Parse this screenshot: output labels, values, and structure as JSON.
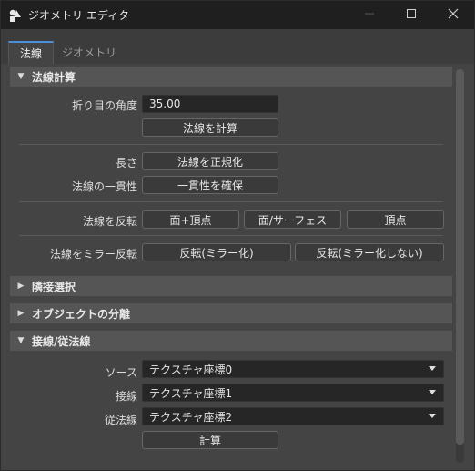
{
  "window": {
    "title": "ジオメトリ エディタ",
    "app_icon": "geometry-editor-icon",
    "minimize_icon": "minimize-icon",
    "maximize_icon": "maximize-icon",
    "close_icon": "close-icon"
  },
  "tabs": [
    {
      "label": "法線",
      "active": true
    },
    {
      "label": "ジオメトリ",
      "active": false
    }
  ],
  "sections": {
    "normal_calc": {
      "title": "法線計算",
      "expanded": true,
      "crease_angle_label": "折り目の角度",
      "crease_angle_value": "35.00",
      "compute_normals_button": "法線を計算",
      "length_label": "長さ",
      "normalize_button": "法線を正規化",
      "consistency_label": "法線の一貫性",
      "ensure_consistency_button": "一貫性を確保",
      "flip_label": "法線を反転",
      "flip_buttons": [
        "面+頂点",
        "面/サーフェス",
        "頂点"
      ],
      "mirror_flip_label": "法線をミラー反転",
      "mirror_buttons": [
        "反転(ミラー化)",
        "反転(ミラー化しない)"
      ]
    },
    "adjacency": {
      "title": "隣接選択",
      "expanded": false
    },
    "object_split": {
      "title": "オブジェクトの分離",
      "expanded": false
    },
    "tangent": {
      "title": "接線/従法線",
      "expanded": true,
      "source_label": "ソース",
      "source_value": "テクスチャ座標0",
      "tangent_label": "接線",
      "tangent_value": "テクスチャ座標1",
      "binormal_label": "従法線",
      "binormal_value": "テクスチャ座標2",
      "compute_button": "計算"
    }
  },
  "colors": {
    "window_bg": "#444444",
    "titlebar_bg": "#1f1f1f",
    "section_header_bg": "#555555",
    "field_bg": "#262626",
    "tab_accent": "#4b8fd6"
  }
}
